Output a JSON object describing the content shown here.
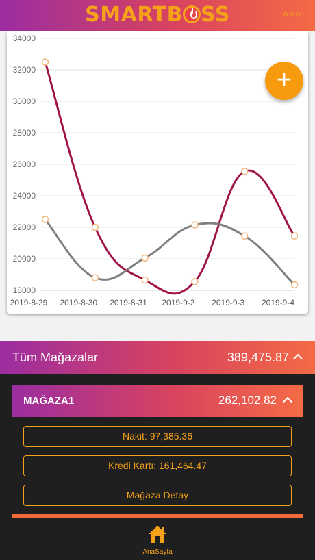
{
  "header": {
    "logo_left": "SMARTB",
    "logo_right": "SS",
    "menu_icon": "more-dots-icon"
  },
  "colors": {
    "accent": "#f6a11a",
    "series_1": "#a0134a",
    "series_2": "#7f7f7f",
    "background": "#1f1f1f"
  },
  "chart_data": {
    "type": "line",
    "categories": [
      "2019-8-29",
      "2019-8-30",
      "2019-8-31",
      "2019-9-2",
      "2019-9-3",
      "2019-9-4"
    ],
    "series": [
      {
        "values": [
          32500,
          22000,
          18650,
          18550,
          25550,
          21450
        ]
      },
      {
        "values": [
          22500,
          18800,
          20050,
          22150,
          21450,
          18350
        ]
      }
    ],
    "yticks": [
      18000,
      20000,
      22000,
      24000,
      26000,
      28000,
      30000,
      32000,
      34000
    ],
    "ylim": [
      18000,
      34000
    ],
    "grid": true,
    "smooth": true,
    "legend": "none"
  },
  "fab": {
    "label": "+"
  },
  "summary": {
    "label": "Tüm Mağazalar",
    "value": "389,475.87"
  },
  "store": {
    "name": "MAĞAZA1",
    "total": "262,102.82",
    "cash": "Nakit: 97,385.36",
    "card": "Kredi Kartı: 161,464.47",
    "detail_button": "Mağaza Detay"
  },
  "tabbar": {
    "home_label": "AnaSayfa",
    "home_icon": "home-icon"
  }
}
